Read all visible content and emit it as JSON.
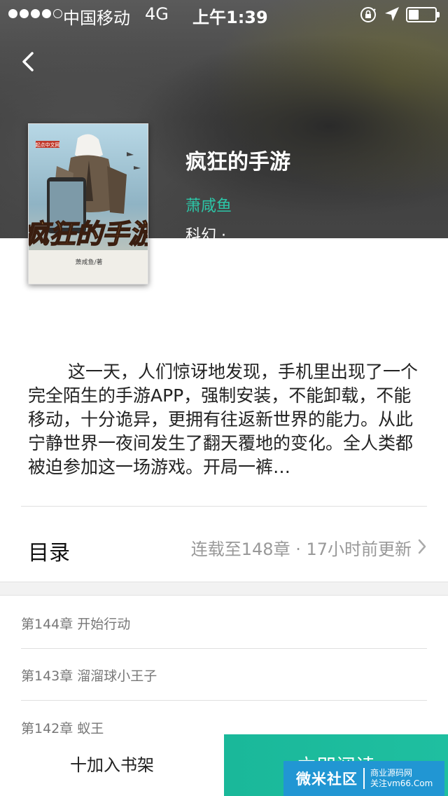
{
  "status_bar": {
    "carrier": "中国移动",
    "network": "4G",
    "time": "上午1:39",
    "signal_bars_filled": 4,
    "signal_bars_total": 5,
    "battery_level": 0.4
  },
  "book": {
    "title": "疯狂的手游",
    "author": "萧咸鱼",
    "genre": "科幻 ·",
    "cover": {
      "title_art": "疯狂的手游",
      "publisher_mark": "起点中文网",
      "author_mark": "萧咸鱼/著"
    },
    "description": "这一天，人们惊讶地发现，手机里出现了一个完全陌生的手游APP，强制安装，不能卸载，不能移动，十分诡异，更拥有往返新世界的能力。从此宁静世界一夜间发生了翻天覆地的变化。全人类都被迫参加这一场游戏。开局一裤…"
  },
  "catalog": {
    "label": "目录",
    "status": "连载至148章 · 17小时前更新"
  },
  "chapters": [
    {
      "label": "第144章 开始行动"
    },
    {
      "label": "第143章 溜溜球小王子"
    },
    {
      "label": "第142章 蚁王"
    }
  ],
  "actions": {
    "add_to_shelf": "十加入书架",
    "read_now": "立即阅读"
  },
  "watermark": {
    "name": "微米社区",
    "line1": "商业源码网",
    "line2": "关注vm66.Com"
  },
  "colors": {
    "accent": "#1fbfa0",
    "author": "#2cc7a8",
    "watermark": "#2196d3"
  }
}
